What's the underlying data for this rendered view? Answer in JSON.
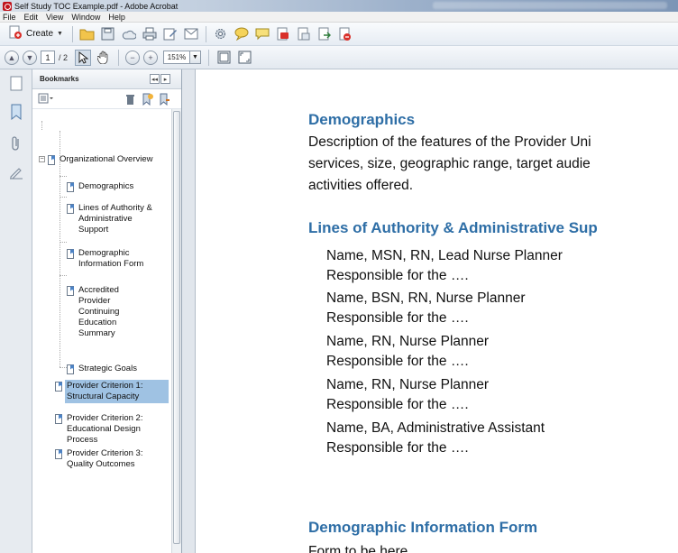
{
  "window": {
    "title": "Self Study TOC Example.pdf - Adobe Acrobat"
  },
  "menu": [
    "File",
    "Edit",
    "View",
    "Window",
    "Help"
  ],
  "toolbar": {
    "create_label": "Create",
    "page_current": "1",
    "page_total": "/ 2",
    "zoom": "151%"
  },
  "bookmarks": {
    "title": "Bookmarks",
    "items": [
      {
        "label": "Organizational Overview"
      },
      {
        "label": "Demographics"
      },
      {
        "label": "Lines of Authority & Administrative Support"
      },
      {
        "label": "Demographic Information Form"
      },
      {
        "label": "Accredited Provider Continuing Education Summary"
      },
      {
        "label": "Strategic Goals"
      },
      {
        "label": "Provider Criterion 1: Structural Capacity"
      },
      {
        "label": "Provider Criterion 2: Educational Design Process"
      },
      {
        "label": "Provider Criterion 3: Quality Outcomes"
      }
    ]
  },
  "document": {
    "h1": "Demographics",
    "desc_lines": [
      "Description of the features of the Provider Uni",
      "services, size, geographic range, target audie",
      "activities offered."
    ],
    "h2": "Lines of Authority & Administrative Sup",
    "staff": [
      {
        "name": "Name, MSN, RN, Lead Nurse Planner",
        "resp": "Responsible for the …."
      },
      {
        "name": "Name, BSN, RN, Nurse Planner",
        "resp": "Responsible for the …."
      },
      {
        "name": "Name, RN, Nurse Planner",
        "resp": "Responsible for the …."
      },
      {
        "name": "Name, RN, Nurse Planner",
        "resp": "Responsible for the …."
      },
      {
        "name": "Name, BA, Administrative Assistant",
        "resp": "Responsible for the …."
      }
    ],
    "h3": "Demographic Information Form",
    "form_line": "Form to be here"
  },
  "colors": {
    "heading": "#2e6ea6",
    "selection": "#9fc2e3"
  }
}
